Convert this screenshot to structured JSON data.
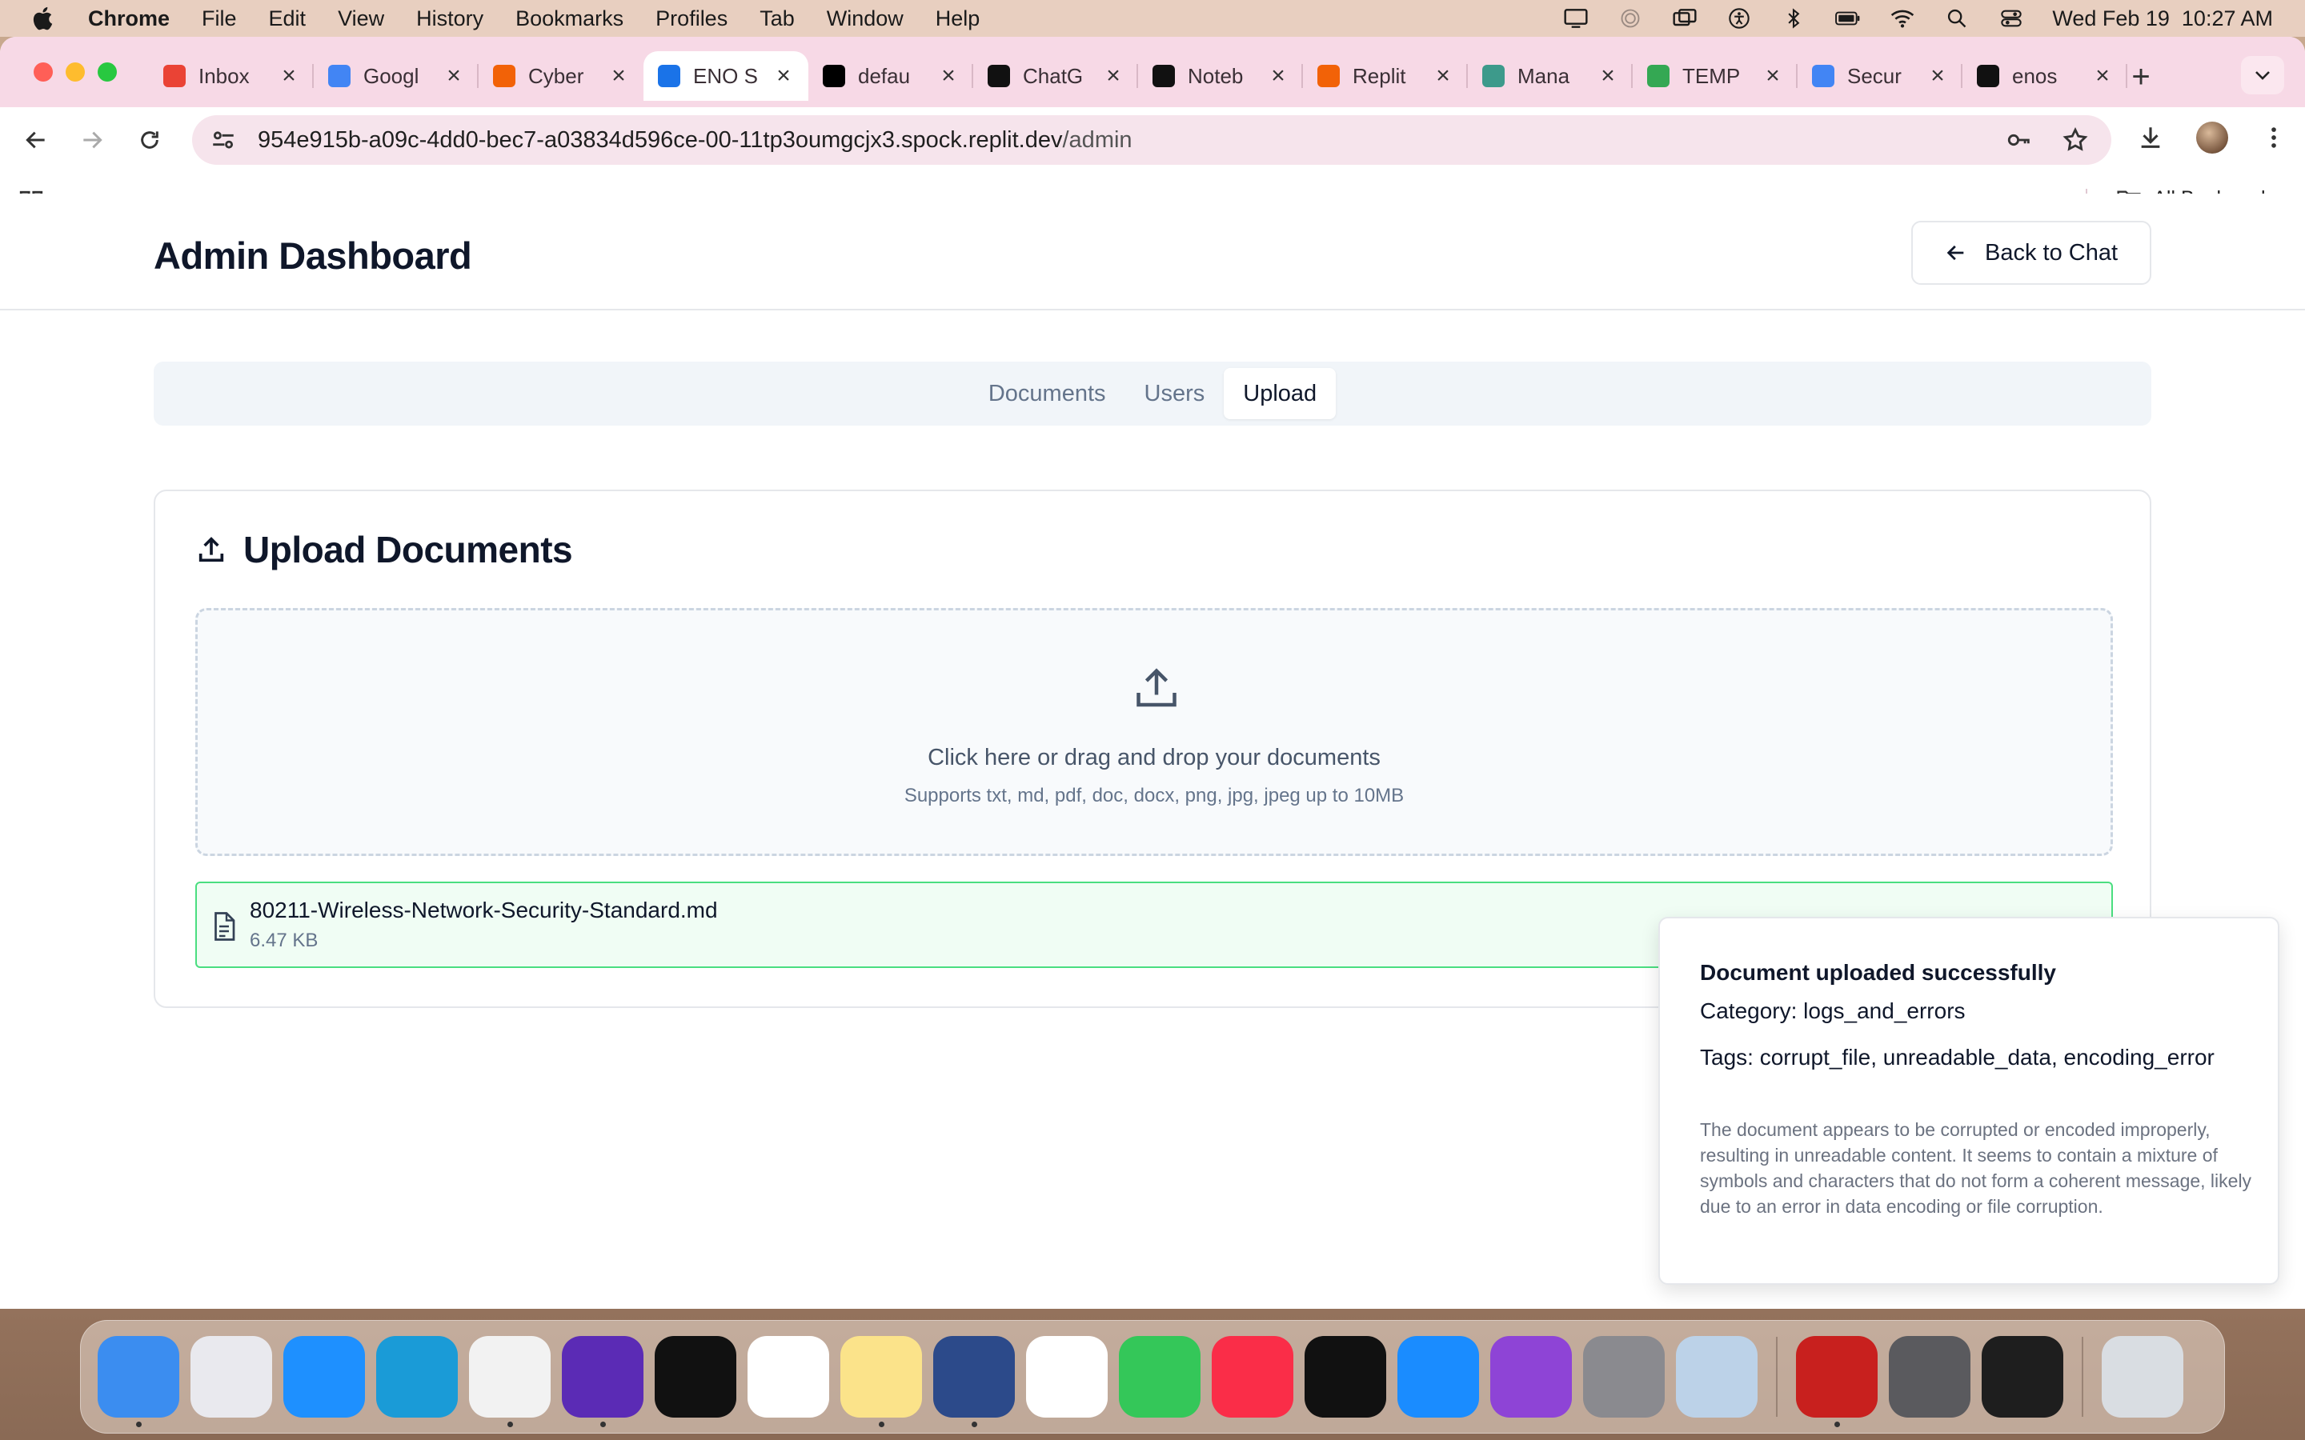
{
  "menubar": {
    "app_name": "Chrome",
    "items": [
      "File",
      "Edit",
      "View",
      "History",
      "Bookmarks",
      "Profiles",
      "Tab",
      "Window",
      "Help"
    ],
    "clock": "Wed Feb 19  10:27 AM"
  },
  "browser": {
    "tabs": [
      {
        "label": "Inbox",
        "icon": "gmail-icon",
        "color": "#ea4335"
      },
      {
        "label": "Googl",
        "icon": "google-calendar-icon",
        "color": "#4285f4"
      },
      {
        "label": "Cyber",
        "icon": "replit-icon",
        "color": "#f26207"
      },
      {
        "label": "ENO S",
        "icon": "shield-icon",
        "color": "#1a73e8",
        "active": true
      },
      {
        "label": "defau",
        "icon": "x-icon",
        "color": "#000000"
      },
      {
        "label": "ChatG",
        "icon": "chatgpt-icon",
        "color": "#111111"
      },
      {
        "label": "Noteb",
        "icon": "notebooklm-icon",
        "color": "#111111"
      },
      {
        "label": "Replit",
        "icon": "replit-icon",
        "color": "#f26207"
      },
      {
        "label": "Mana",
        "icon": "h-icon",
        "color": "#3d9a8b"
      },
      {
        "label": "TEMP",
        "icon": "google-drive-icon",
        "color": "#34a853"
      },
      {
        "label": "Secur",
        "icon": "google-docs-icon",
        "color": "#4285f4"
      },
      {
        "label": "enos",
        "icon": "github-icon",
        "color": "#111111"
      }
    ],
    "url_host": "954e915b-a09c-4dd0-bec7-a03834d596ce-00-11tp3oumgcjx3.spock.replit.dev",
    "url_path": "/admin",
    "all_bookmarks": "All Bookmarks"
  },
  "page": {
    "title": "Admin Dashboard",
    "back_button": "Back to Chat",
    "tabs": [
      {
        "label": "Documents",
        "active": false
      },
      {
        "label": "Users",
        "active": false
      },
      {
        "label": "Upload",
        "active": true
      }
    ],
    "upload_card": {
      "title": "Upload Documents",
      "dropzone_text": "Click here or drag and drop your documents",
      "dropzone_hint": "Supports txt, md, pdf, doc, docx, png, jpg, jpeg up to 10MB",
      "file": {
        "name": "80211-Wireless-Network-Security-Standard.md",
        "size": "6.47 KB"
      }
    }
  },
  "toast": {
    "title": "Document uploaded successfully",
    "category": "Category: logs_and_errors",
    "tags": "Tags: corrupt_file, unreadable_data, encoding_error",
    "description": "The document appears to be corrupted or encoded improperly, resulting in unreadable content. It seems to contain a mixture of symbols and characters that do not form a coherent message, likely due to an error in data encoding or file corruption."
  },
  "dock": {
    "apps": [
      {
        "icon": "finder-icon",
        "color": "#3b8df0",
        "running": true
      },
      {
        "icon": "launchpad-icon",
        "color": "#e9e9ee",
        "running": false
      },
      {
        "icon": "safari-icon",
        "color": "#1e90ff",
        "running": false
      },
      {
        "icon": "edge-icon",
        "color": "#1a9bd7",
        "running": false
      },
      {
        "icon": "chrome-icon",
        "color": "#f2f2f2",
        "running": true
      },
      {
        "icon": "firefox-icon",
        "color": "#5b2bb5",
        "running": true
      },
      {
        "icon": "linear-icon",
        "color": "#111111",
        "running": false
      },
      {
        "icon": "calendar-icon",
        "color": "#ffffff",
        "running": false
      },
      {
        "icon": "notes-icon",
        "color": "#fbe38a",
        "running": true
      },
      {
        "icon": "prism-icon",
        "color": "#2c4a8a",
        "running": true
      },
      {
        "icon": "photos-icon",
        "color": "#ffffff",
        "running": false
      },
      {
        "icon": "messages-icon",
        "color": "#34c759",
        "running": false
      },
      {
        "icon": "music-icon",
        "color": "#fa2d48",
        "running": false
      },
      {
        "icon": "tv-icon",
        "color": "#111111",
        "running": false
      },
      {
        "icon": "app-store-icon",
        "color": "#1a8cff",
        "running": false
      },
      {
        "icon": "podcasts-icon",
        "color": "#8e44d6",
        "running": false
      },
      {
        "icon": "settings-icon",
        "color": "#8a8a8f",
        "running": false
      },
      {
        "icon": "preview-icon",
        "color": "#bcd2e8",
        "running": false
      }
    ],
    "recent": [
      {
        "icon": "acrobat-icon",
        "color": "#c8201e",
        "running": true
      },
      {
        "icon": "screenshot-icon",
        "color": "#5a5a5e",
        "running": false
      },
      {
        "icon": "terminal-icon",
        "color": "#1e1e1e",
        "running": false
      }
    ],
    "trash": {
      "icon": "trash-icon",
      "color": "#d9dde2"
    }
  }
}
